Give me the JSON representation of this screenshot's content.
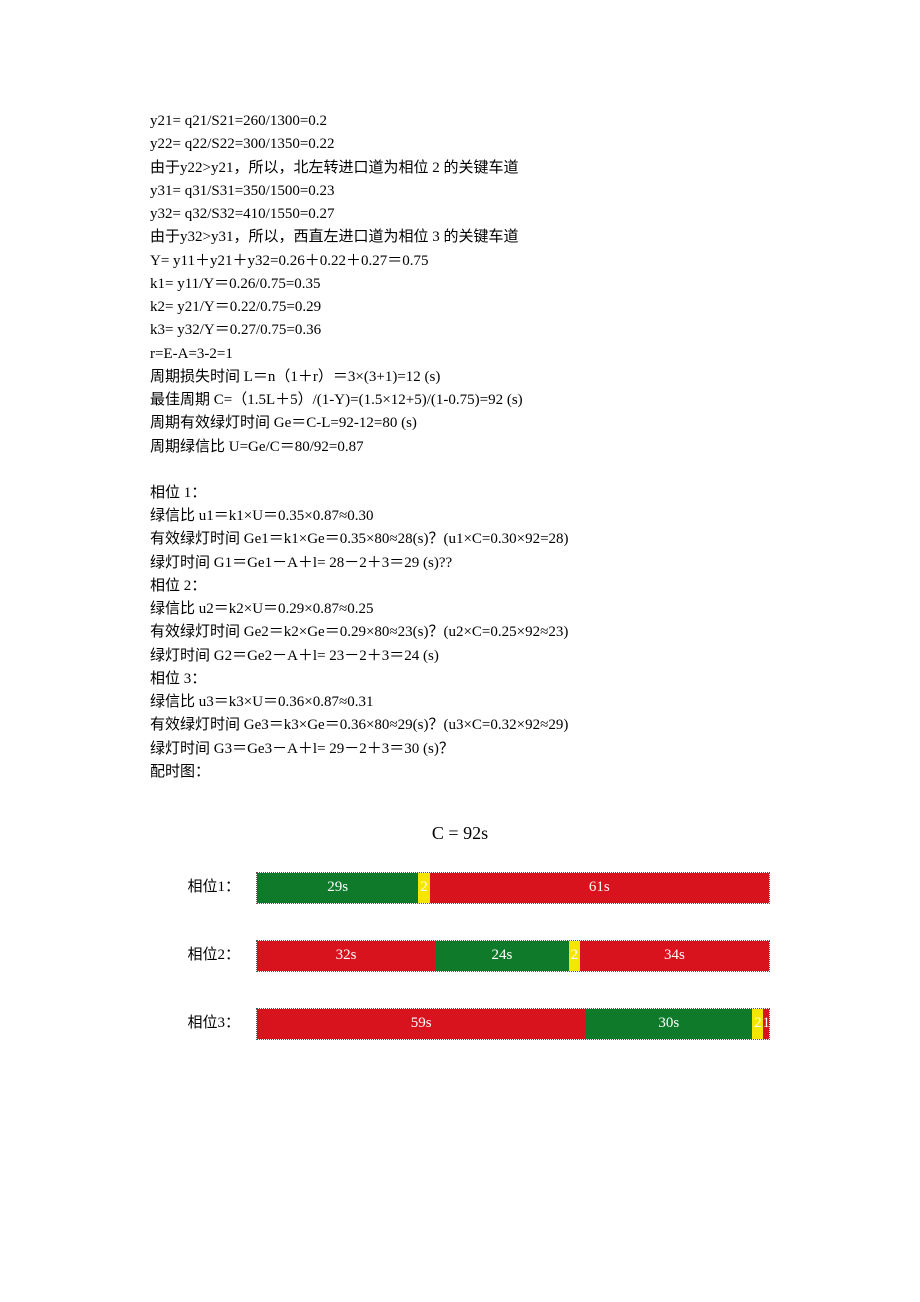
{
  "lines": [
    "y21= q21/S21=260/1300=0.2",
    "y22= q22/S22=300/1350=0.22",
    "由于y22>y21，所以，北左转进口道为相位 2 的关键车道",
    "y31= q31/S31=350/1500=0.23",
    "y32= q32/S32=410/1550=0.27",
    "由于y32>y31，所以，西直左进口道为相位 3 的关键车道",
    "Y= y11＋y21＋y32=0.26＋0.22＋0.27＝0.75",
    "k1= y11/Y＝0.26/0.75=0.35",
    "k2= y21/Y＝0.22/0.75=0.29",
    "k3= y32/Y＝0.27/0.75=0.36",
    "r=E-A=3-2=1",
    "周期损失时间 L＝n（1＋r）＝3×(3+1)=12 (s)",
    "最佳周期 C=（1.5L＋5）/(1-Y)=(1.5×12+5)/(1-0.75)=92 (s)",
    "周期有效绿灯时间 Ge＝C-L=92-12=80 (s)",
    "周期绿信比 U=Ge/C＝80/92=0.87",
    "",
    "相位 1：",
    "绿信比 u1＝k1×U＝0.35×0.87≈0.30",
    "有效绿灯时间 Ge1＝k1×Ge＝0.35×80≈28(s)？(u1×C=0.30×92=28)",
    "绿灯时间 G1＝Ge1－A＋l= 28－2＋3＝29 (s)??",
    "相位 2：",
    "绿信比 u2＝k2×U＝0.29×0.87≈0.25",
    "有效绿灯时间 Ge2＝k2×Ge＝0.29×80≈23(s)？(u2×C=0.25×92≈23)",
    "绿灯时间 G2＝Ge2－A＋l= 23－2＋3＝24 (s)",
    "相位 3：",
    "绿信比 u3＝k3×U＝0.36×0.87≈0.31",
    "有效绿灯时间 Ge3＝k3×Ge＝0.36×80≈29(s)？(u3×C=0.32×92≈29)",
    "绿灯时间 G3＝Ge3－A＋l= 29－2＋3＝30 (s)？",
    "配时图："
  ],
  "chart_data": {
    "type": "bar",
    "title": "C = 92s",
    "ylabel": "相位",
    "xlabel": "",
    "cycle": 92,
    "phases": [
      {
        "name": "相位1：",
        "segments": [
          {
            "color": "green",
            "label": "29s",
            "value": 29
          },
          {
            "color": "yellow",
            "label": "2",
            "value": 2
          },
          {
            "color": "red",
            "label": "61s",
            "value": 61
          }
        ]
      },
      {
        "name": "相位2：",
        "segments": [
          {
            "color": "red",
            "label": "32s",
            "value": 32
          },
          {
            "color": "green",
            "label": "24s",
            "value": 24
          },
          {
            "color": "yellow",
            "label": "2",
            "value": 2
          },
          {
            "color": "red",
            "label": "34s",
            "value": 34
          }
        ]
      },
      {
        "name": "相位3：",
        "segments": [
          {
            "color": "red",
            "label": "59s",
            "value": 59
          },
          {
            "color": "green",
            "label": "30s",
            "value": 30
          },
          {
            "color": "yellow",
            "label": "2",
            "value": 2
          },
          {
            "color": "red",
            "label": "1",
            "value": 1
          }
        ]
      }
    ]
  }
}
